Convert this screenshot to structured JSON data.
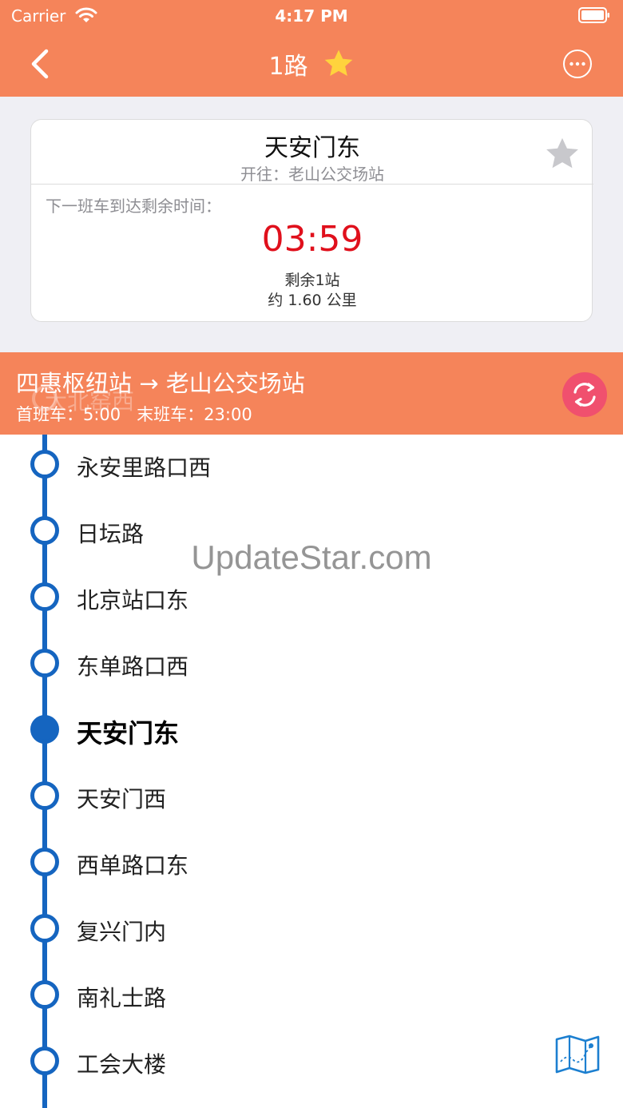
{
  "status_bar": {
    "carrier": "Carrier",
    "time": "4:17 PM"
  },
  "nav": {
    "title": "1路"
  },
  "next_bus_card": {
    "station": "天安门东",
    "direction": "开往：老山公交场站",
    "next_label": "下一班车到达剩余时间：",
    "countdown": "03:59",
    "stops_remaining": "剩余1站",
    "distance": "约 1.60 公里"
  },
  "route_bar": {
    "ghost_stop": "大北窑西",
    "route_name": "四惠枢纽站 → 老山公交场站",
    "first_bus": "首班车：5:00",
    "last_bus": "末班车：23:00"
  },
  "stops": [
    {
      "name": "永安里路口西"
    },
    {
      "name": "日坛路"
    },
    {
      "name": "北京站口东"
    },
    {
      "name": "东单路口西"
    },
    {
      "name": "天安门东",
      "current": true
    },
    {
      "name": "天安门西"
    },
    {
      "name": "西单路口东"
    },
    {
      "name": "复兴门内"
    },
    {
      "name": "南礼士路"
    },
    {
      "name": "工会大楼"
    }
  ],
  "watermark": "UpdateStar.com",
  "colors": {
    "header": "#f5845a",
    "line": "#1565c0",
    "countdown": "#e0101c",
    "swap_button": "#f0506e",
    "star": "#ffd33d"
  },
  "icons": {
    "back": "back-chevron-icon",
    "favorite": "star-icon",
    "more": "more-icon",
    "swap": "swap-direction-icon",
    "map": "map-icon"
  }
}
